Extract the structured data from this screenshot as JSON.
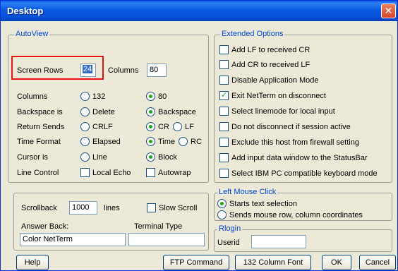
{
  "window": {
    "title": "Desktop",
    "close_glyph": "✕"
  },
  "autoview": {
    "legend": "AutoView",
    "screen_rows_label": "Screen Rows",
    "screen_rows_value": "24",
    "columns_label": "Columns",
    "columns_value": "80",
    "rows": [
      {
        "label": "Columns",
        "opt1": "132",
        "opt2": "80"
      },
      {
        "label": "Backspace is",
        "opt1": "Delete",
        "opt2": "Backspace"
      },
      {
        "label": "Return Sends",
        "opt1": "CRLF",
        "opt2": "CR",
        "opt3": "LF"
      },
      {
        "label": "Time Format",
        "opt1": "Elapsed",
        "opt2": "Time",
        "opt3": "RC"
      },
      {
        "label": "Cursor is",
        "opt1": "Line",
        "opt2": "Block"
      },
      {
        "label": "Line Control",
        "opt1": "Local Echo",
        "opt2": "Autowrap"
      }
    ]
  },
  "extended": {
    "legend": "Extended Options",
    "options": [
      "Add LF to received CR",
      "Add CR to received LF",
      "Disable Application Mode",
      "Exit NetTerm on disconnect",
      "Select linemode for local input",
      "Do not disconnect if session active",
      "Exclude this host from firewall setting",
      "Add input data window to the StatusBar",
      "Select IBM PC compatible keyboard mode"
    ],
    "check_glyph": "✓"
  },
  "bottom": {
    "scrollback_label": "Scrollback",
    "scrollback_value": "1000",
    "lines_label": "lines",
    "slow_scroll_label": "Slow Scroll",
    "answer_back_label": "Answer Back:",
    "answer_back_value": "Color NetTerm",
    "terminal_type_label": "Terminal Type",
    "terminal_type_value": ""
  },
  "mouse": {
    "legend": "Left Mouse Click",
    "opt1": "Starts text selection",
    "opt2": "Sends mouse row, column coordinates"
  },
  "rlogin": {
    "legend": "Rlogin",
    "userid_label": "Userid",
    "userid_value": ""
  },
  "buttons": {
    "help": "Help",
    "ftp": "FTP Command",
    "font": "132 Column Font",
    "ok": "OK",
    "cancel": "Cancel"
  }
}
